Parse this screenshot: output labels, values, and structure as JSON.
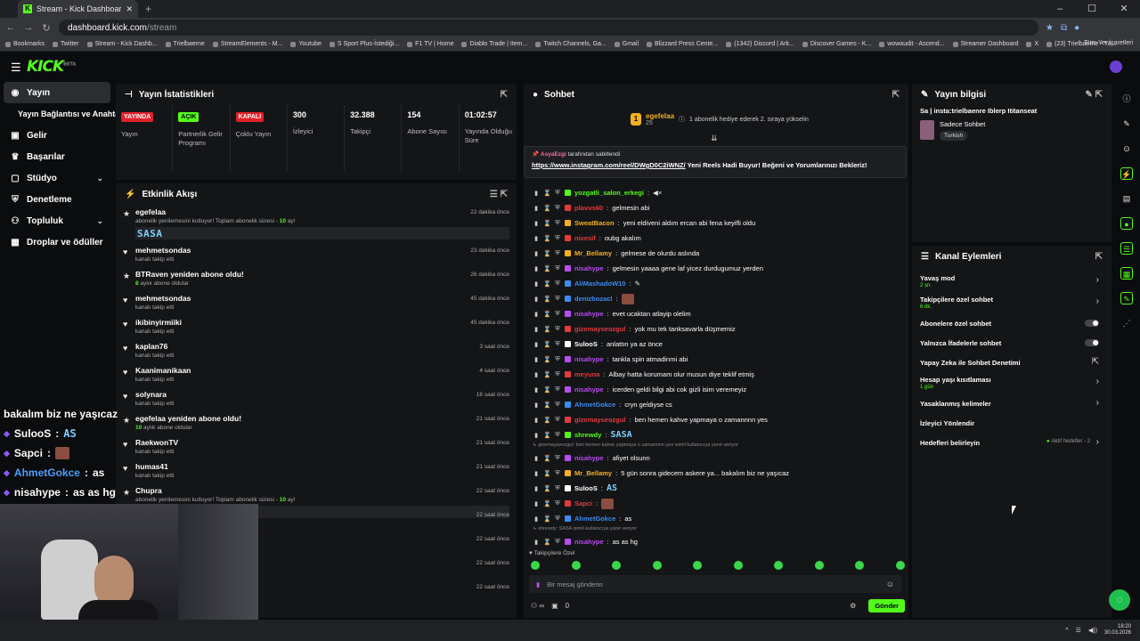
{
  "browser": {
    "tab_title": "Stream - Kick Dashboard",
    "tab_icon": "K",
    "url_host": "dashboard.kick.com",
    "url_path": "/stream",
    "bookmarks": [
      "Bookmarks",
      "Twitter",
      "Stream - Kick Dashb...",
      "Trielbaerne",
      "StreamElements - M...",
      "Youtube",
      "S Sport Plus-İstediği...",
      "F1 TV | Home",
      "Diablo Trade | Item...",
      "Twitch Channels, Ga...",
      "Gmail",
      "Blizzard Press Cente...",
      "(1342) Discord | Ark...",
      "Discover Games - K...",
      "wowaudit - Ascend...",
      "Streamer Dashboard",
      "X",
      "(23) Trielbaerne - Yo..."
    ],
    "all_bookmarks": "Tüm Yer İşaretleri"
  },
  "brand": {
    "logo": "KICK",
    "beta": "BETA",
    "accent": "#53fc18"
  },
  "sidebar": {
    "items": [
      {
        "label": "Yayın",
        "icon": "broadcast-icon",
        "active": true
      },
      {
        "label": "Yayın Bağlantısı ve Anahtarı",
        "sub": true
      },
      {
        "label": "Gelir",
        "icon": "money-icon"
      },
      {
        "label": "Başarılar",
        "icon": "trophy-icon"
      },
      {
        "label": "Stüdyo",
        "icon": "studio-icon",
        "chevron": "⌄"
      },
      {
        "label": "Denetleme",
        "icon": "shield-icon"
      },
      {
        "label": "Topluluk",
        "icon": "community-icon",
        "chevron": "⌄"
      },
      {
        "label": "Droplar ve ödüller",
        "icon": "gift-icon"
      }
    ]
  },
  "stats": {
    "title": "Yayın İstatistikleri",
    "cells": [
      {
        "badge": "YAYINDA",
        "label": "Yayın",
        "color": "red"
      },
      {
        "badge": "AÇIK",
        "label": "Partnerlik Gelir Programı",
        "color": "green"
      },
      {
        "badge": "KAPALI",
        "label": "Çoklu Yayın",
        "color": "red"
      },
      {
        "value": "300",
        "label": "İzleyici"
      },
      {
        "value": "32.388",
        "label": "Takipçi"
      },
      {
        "value": "154",
        "label": "Abone Sayısı"
      },
      {
        "value": "01:02:57",
        "label": "Yayında Olduğu Süre"
      }
    ]
  },
  "activity": {
    "title": "Etkinlik Akışı",
    "items": [
      {
        "user": "egefelaa",
        "desc": "abonelik yenilemesini kutluyor! Toplam abonelik süresi - ",
        "months": "10",
        "suffix": " ay!",
        "time": "22 dakika önce",
        "emote": "SASA",
        "icon": "★"
      },
      {
        "user": "mehmetsondas",
        "desc": "kanalı takip etti",
        "time": "23 dakika önce",
        "icon": "♥"
      },
      {
        "user": "BTRaven yeniden abone oldu!",
        "desc": "aylık abone oldular",
        "months": "8",
        "time": "26 dakika önce",
        "icon": "★"
      },
      {
        "user": "mehmetsondas",
        "desc": "kanalı takip etti",
        "time": "45 dakika önce",
        "icon": "♥"
      },
      {
        "user": "ikibinyirmiiki",
        "desc": "kanalı takip etti",
        "time": "45 dakika önce",
        "icon": "♥"
      },
      {
        "user": "kaplan76",
        "desc": "kanalı takip etti",
        "time": "3 saat önce",
        "icon": "♥"
      },
      {
        "user": "Kaanimanikaan",
        "desc": "kanalı takip etti",
        "time": "4 saat önce",
        "icon": "♥"
      },
      {
        "user": "solynara",
        "desc": "kanalı takip etti",
        "time": "16 saat önce",
        "icon": "♥"
      },
      {
        "user": "egefelaa yeniden abone oldu!",
        "desc": "aylık abone oldular",
        "months": "10",
        "time": "21 saat önce",
        "icon": "★"
      },
      {
        "user": "RaekwonTV",
        "desc": "kanalı takip etti",
        "time": "21 saat önce",
        "icon": "♥"
      },
      {
        "user": "humas41",
        "desc": "kanalı takip etti",
        "time": "21 saat önce",
        "icon": "♥"
      },
      {
        "user": "Chupra",
        "desc": "abonelik yenilemesini kutluyor! Toplam abonelik süresi - ",
        "months": "10",
        "suffix": " ay!",
        "time": "22 saat önce",
        "icon": "★",
        "bar": true
      },
      {
        "user": "",
        "desc": "",
        "time": "22 saat önce",
        "icon": ""
      },
      {
        "user": "",
        "desc": "",
        "time": "22 saat önce",
        "icon": ""
      },
      {
        "user": "",
        "desc": "",
        "time": "22 saat önce",
        "icon": ""
      },
      {
        "user": "",
        "desc": "",
        "time": "22 saat önce",
        "icon": ""
      }
    ]
  },
  "chat": {
    "title": "Sohbet",
    "gift_user": "egefelaa",
    "gift_count": "25",
    "gift_text": "1 abonelik hediye ederek 2. sıraya yükselin",
    "pinned_by_user": "AsyaEzgi",
    "pinned_by_text": "tarafından sabitlendi",
    "pinned_link": "https://www.instagram.com/reel/DWgD0C2iWNZ/",
    "pinned_text": " Yeni Reels Hadi Buyur! Beğeni ve Yorumlarınızı Bekleriz!",
    "messages": [
      {
        "user": "yozgatli_salon_erkegi",
        "color": "#53fc18",
        "text": "",
        "icon": "🔇"
      },
      {
        "user": "plavus60",
        "color": "#e33b3b",
        "text": "gelmesin abi"
      },
      {
        "user": "SweatBacon",
        "color": "#f2b01e",
        "text": "yeni eldiveni aldım ercan abi fena keyifli oldu"
      },
      {
        "user": "nixesif",
        "color": "#e33b3b",
        "text": "oubg akalım"
      },
      {
        "user": "Mr_Bellamy",
        "color": "#f2b01e",
        "text": "gelmese de olurdu aslında"
      },
      {
        "user": "nisahype",
        "color": "#b84cf0",
        "text": "gelmesin yaaaa gene laf yicez durdugumuz yerden"
      },
      {
        "user": "AliMashadoW10",
        "color": "#3b8cf0",
        "text": "",
        "emoji": "feather"
      },
      {
        "user": "denizbozacl",
        "color": "#3b8cf0",
        "text": "",
        "pic": true
      },
      {
        "user": "nisahype",
        "color": "#b84cf0",
        "text": "evet ucaktan atlayip olelim"
      },
      {
        "user": "gizemayseozgul",
        "color": "#e33b3b",
        "text": "yok mu tek tanksavarla düşmemiz"
      },
      {
        "user": "SulooS",
        "color": "#fff",
        "text": "anlattın ya az önce"
      },
      {
        "user": "nisahype",
        "color": "#b84cf0",
        "text": "tankla spin atmadinmi abi"
      },
      {
        "user": "meyuna",
        "color": "#e33b3b",
        "text": "Albay hatta korumam olur musun diye teklif etmiş"
      },
      {
        "user": "nisahype",
        "color": "#b84cf0",
        "text": "icerden geldi bilgi abi cok gizli isim veremeyiz"
      },
      {
        "user": "AhmetGokce",
        "color": "#3b8cf0",
        "text": "cryn geldiyse cs"
      },
      {
        "user": "gizemayseozgul",
        "color": "#e33b3b",
        "text": "ben hemen kahve yapmaya o zamannnn yes"
      },
      {
        "user": "shrewdy",
        "color": "#53fc18",
        "text": "",
        "emote": "SASA"
      },
      {
        "reply": "gizemayseozgul: ben hemen kahve yapmaya o zamannnn yes isimli kullanıcıya yanıt veriyor"
      },
      {
        "user": "nisahype",
        "color": "#b84cf0",
        "text": "afiyet olsunn"
      },
      {
        "user": "Mr_Bellamy",
        "color": "#f2b01e",
        "text": "5 gün sonra gidecem askere ya... bakalım biz ne yaşıcaz"
      },
      {
        "user": "SulooS",
        "color": "#fff",
        "text": "",
        "emote": "AS"
      },
      {
        "user": "Sapci",
        "color": "#e33b3b",
        "text": "",
        "pic": true
      },
      {
        "user": "AhmetGokce",
        "color": "#3b8cf0",
        "text": "as"
      },
      {
        "reply": "shrewdy: SASA isimli kullanıcıya yanıt veriyor"
      },
      {
        "user": "nisahype",
        "color": "#b84cf0",
        "text": "as as hg"
      }
    ],
    "followers_only": "Takipçilere Özel",
    "input_placeholder": "Bir mesaj gönderin",
    "send": "Gönder",
    "footer_count": "0"
  },
  "stream_info": {
    "title": "Yayın bilgisi",
    "stream_title": "Sa | insta:trielbaenre Iblerp Ititanseat",
    "category": "Sadece Sohbet",
    "tag": "Turkish"
  },
  "channel_actions": {
    "title": "Kanal Eylemleri",
    "rows": [
      {
        "label": "Yavaş mod",
        "sub": "2 sn.",
        "control": "chevron"
      },
      {
        "label": "Takipçilere özel sohbet",
        "sub": "6 dk.",
        "control": "chevron"
      },
      {
        "label": "Abonelere özel sohbet",
        "control": "toggle"
      },
      {
        "label": "Yalnızca İfadelerle sohbet",
        "control": "toggle"
      },
      {
        "label": "Yapay Zeka ile Sohbet Denetimi",
        "control": "external"
      },
      {
        "label": "Hesap yaşı kısıtlaması",
        "sub": "1 gün",
        "control": "chevron"
      },
      {
        "label": "Yasaklanmış kelimeler",
        "control": "chevron"
      },
      {
        "label": "İzleyici Yönlendir",
        "control": "none"
      },
      {
        "label": "Hedefleri belirleyin",
        "control": "chevron",
        "goal": "Aktif hedefler - 2"
      }
    ]
  },
  "overlay_chat": [
    {
      "user": "",
      "text": "bakalım biz ne yaşıcaz"
    },
    {
      "user": "SulooS",
      "color": "#ffffff",
      "emote": "AS"
    },
    {
      "user": "Sapci",
      "color": "#ffffff",
      "pic": true
    },
    {
      "user": "AhmetGokce",
      "color": "#4aa3ff",
      "text": "as"
    },
    {
      "user": "nisahype",
      "color": "#ffffff",
      "text": "as as hg"
    }
  ],
  "taskbar": {
    "time": "18:20",
    "date": "30.03.2026"
  }
}
